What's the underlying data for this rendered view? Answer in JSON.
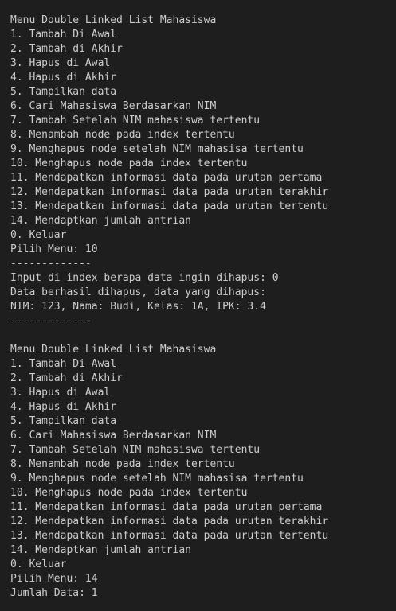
{
  "theme": {
    "background": "#1e1e1e",
    "text": "#cccccc"
  },
  "terminal": {
    "lines": [
      "Menu Double Linked List Mahasiswa",
      "1. Tambah Di Awal",
      "2. Tambah di Akhir",
      "3. Hapus di Awal",
      "4. Hapus di Akhir",
      "5. Tampilkan data",
      "6. Cari Mahasiswa Berdasarkan NIM",
      "7. Tambah Setelah NIM mahasiswa tertentu",
      "8. Menambah node pada index tertentu",
      "9. Menghapus node setelah NIM mahasisa tertentu",
      "10. Menghapus node pada index tertentu",
      "11. Mendapatkan informasi data pada urutan pertama",
      "12. Mendapatkan informasi data pada urutan terakhir",
      "13. Mendapatkan informasi data pada urutan tertentu",
      "14. Mendaptkan jumlah antrian",
      "0. Keluar",
      "Pilih Menu: 10",
      "-------------",
      "Input di index berapa data ingin dihapus: 0",
      "Data berhasil dihapus, data yang dihapus:",
      "NIM: 123, Nama: Budi, Kelas: 1A, IPK: 3.4",
      "-------------",
      "",
      "Menu Double Linked List Mahasiswa",
      "1. Tambah Di Awal",
      "2. Tambah di Akhir",
      "3. Hapus di Awal",
      "4. Hapus di Akhir",
      "5. Tampilkan data",
      "6. Cari Mahasiswa Berdasarkan NIM",
      "7. Tambah Setelah NIM mahasiswa tertentu",
      "8. Menambah node pada index tertentu",
      "9. Menghapus node setelah NIM mahasisa tertentu",
      "10. Menghapus node pada index tertentu",
      "11. Mendapatkan informasi data pada urutan pertama",
      "12. Mendapatkan informasi data pada urutan terakhir",
      "13. Mendapatkan informasi data pada urutan tertentu",
      "14. Mendaptkan jumlah antrian",
      "0. Keluar",
      "Pilih Menu: 14",
      "Jumlah Data: 1"
    ]
  }
}
